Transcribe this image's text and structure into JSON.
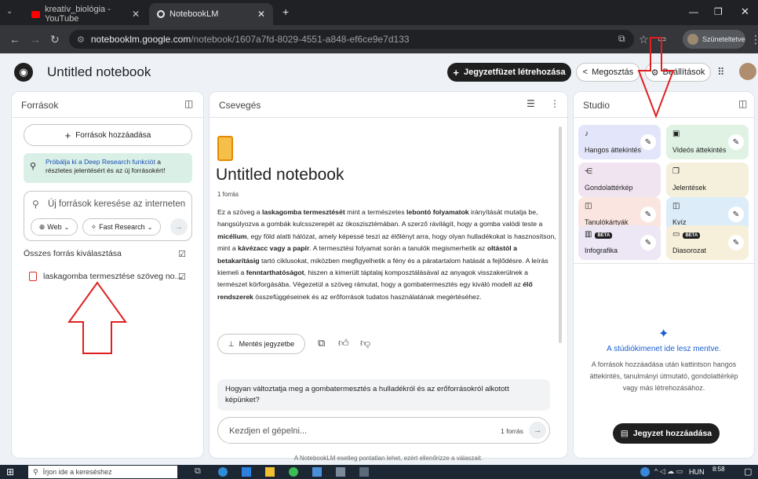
{
  "browser": {
    "tabs": [
      {
        "label": "kreatív_biológia - YouTube"
      },
      {
        "label": "NotebookLM"
      }
    ],
    "url_domain": "notebooklm.google.com",
    "url_path": "/notebook/1607a7fd-8029-4551-a848-ef6ce9e7d133",
    "profile_label": "Szüneteltetve"
  },
  "header": {
    "title": "Untitled notebook",
    "create_label": "Jegyzetfüzet létrehozása",
    "share_label": "Megosztás",
    "settings_label": "Beállítások"
  },
  "sources": {
    "title": "Források",
    "add_label": "Források hozzáadása",
    "banner_link": "Próbálja ki a Deep Research funkciót",
    "banner_rest": " a részletes jelentésért és az új forrásokért!",
    "search_placeholder": "Új források keresése az interneten",
    "web_label": "Web",
    "research_label": "Fast Research",
    "select_all_label": "Összes forrás kiválasztása",
    "items": [
      {
        "label": "laskagomba termesztése szöveg no..."
      }
    ]
  },
  "chat": {
    "title": "Csevegés",
    "notebook_title": "Untitled notebook",
    "source_count": "1 forrás",
    "save_label": "Mentés jegyzetbe",
    "suggestion": "Hogyan változtatja meg a gombatermesztés a hulladékról és az erőforrásokról alkotott képünket?",
    "input_placeholder": "Kezdjen el gépelni...",
    "input_source_count": "1 forrás",
    "disclaimer": "A NotebookLM esetleg pontatlan lehet, ezért ellenőrizze a válaszait."
  },
  "studio": {
    "title": "Studio",
    "cards": [
      {
        "label": "Hangos áttekintés",
        "color": "#e3e6fa"
      },
      {
        "label": "Videós áttekintés",
        "color": "#dff2e3"
      },
      {
        "label": "Gondolattérkép",
        "color": "#f1e4f1"
      },
      {
        "label": "Jelentések",
        "color": "#f5f0dc"
      },
      {
        "label": "Tanulókártyák",
        "color": "#fbe5e1"
      },
      {
        "label": "Kvíz",
        "color": "#dcecf8"
      },
      {
        "label": "Infografika",
        "color": "#ece6f5",
        "badge": "BÉTA"
      },
      {
        "label": "Diasorozat",
        "color": "#f6efd9",
        "badge": "BÉTA"
      }
    ],
    "empty_title": "A stúdiókimenet ide lesz mentve.",
    "empty_text": "A források hozzáadása után kattintson hangos áttekintés, tanulmányi útmutató, gondolattérkép vagy más létrehozásához.",
    "add_note_label": "Jegyzet hozzáadása"
  },
  "taskbar": {
    "search_placeholder": "Írjon ide a kereséshez",
    "lang": "HUN",
    "time": "8:58"
  }
}
